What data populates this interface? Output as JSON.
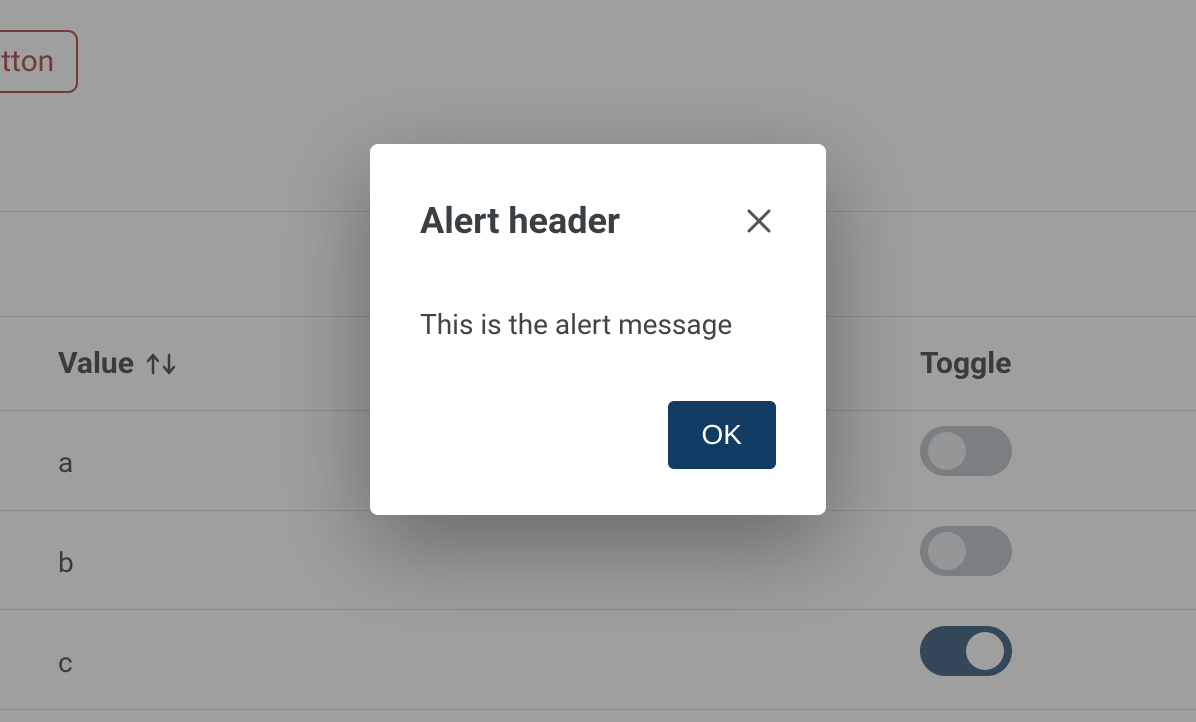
{
  "button_partial_label": "Button",
  "table": {
    "columns": {
      "value": "Value",
      "toggle": "Toggle"
    },
    "rows": [
      {
        "value": "a",
        "toggle": false
      },
      {
        "value": "b",
        "toggle": false
      },
      {
        "value": "c",
        "toggle": true
      }
    ]
  },
  "dialog": {
    "title": "Alert header",
    "message": "This is the alert message",
    "ok_label": "OK"
  }
}
